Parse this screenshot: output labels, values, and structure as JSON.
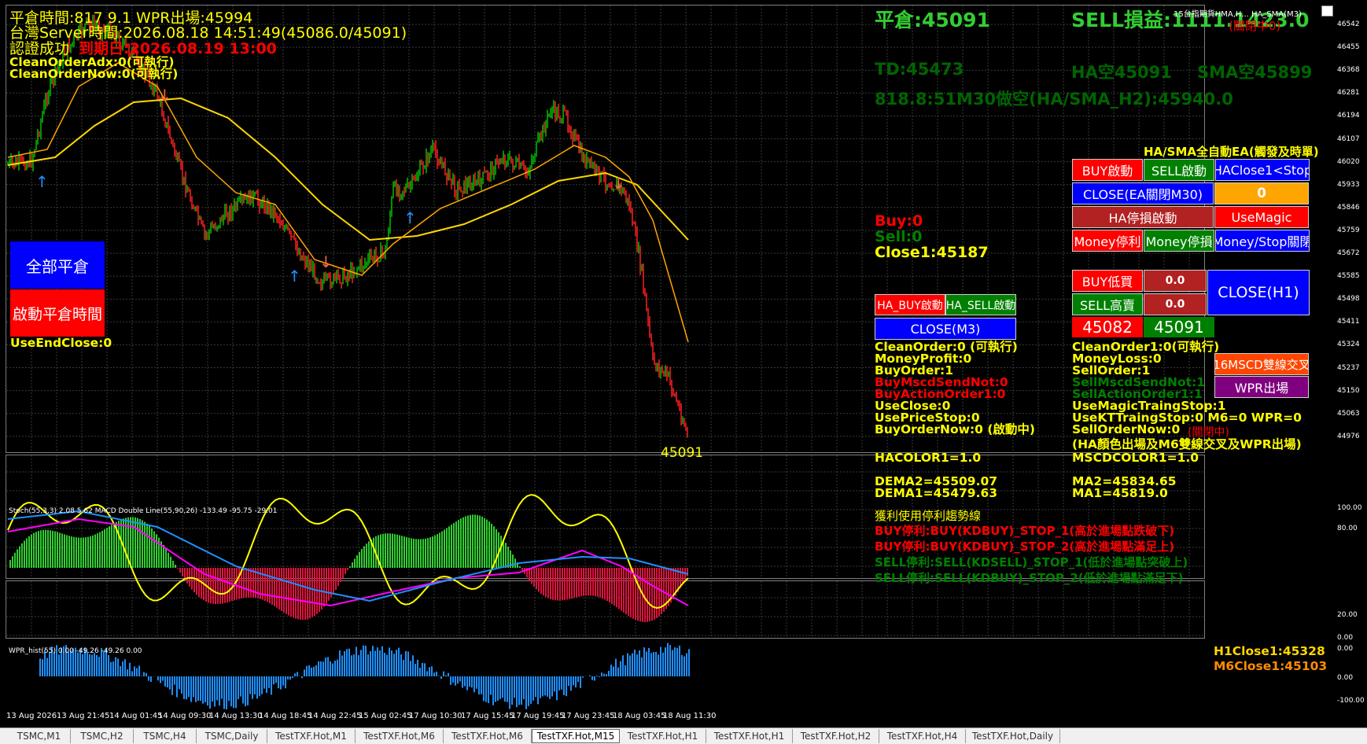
{
  "colors": {
    "bg": "#000000",
    "green": "#32cd32",
    "yellow": "#ffff00",
    "red": "#ff0000",
    "darkgreen": "#008000",
    "orange": "#ff8c00",
    "white": "#ffffff",
    "blue": "#0000ff",
    "purple": "#800080"
  },
  "top_left": {
    "line1": "平倉時間:817 9.1 WPR出場:45994",
    "line2": "台灣Server時間:2026.08.18 14:51:49(45086.0/45091)",
    "line3a": "認證成功",
    "line3b": "到期日:2026.08.19 13:00",
    "line4": "CleanOrderAdx:0(可執行)",
    "line5": "CleanOrderNow:0(可執行)"
  },
  "top_right": {
    "close_label": "平倉:45091",
    "sell_label": "SELL損益:1111.1423.0",
    "lock_status": "(關閉中0)",
    "indicator_label": "15台指期貨HMA,H... HA_SMA(M3)",
    "td": "TD:45473",
    "ha": "HA空45091",
    "sma": "SMA空45899",
    "m30": "818.8:51M30做空(HA/SMA_H2):45940.0"
  },
  "left_buttons": {
    "close_all": "全部平倉",
    "start_close_time": "啟動平倉時間",
    "use_end_close": "UseEndClose:0"
  },
  "mid_panel": {
    "buy": "Buy:0",
    "sell": "Sell:0",
    "close1": "Close1:45187",
    "ha_buy": "HA_BUY啟動",
    "ha_sell": "HA_SELL啟動",
    "close_m3": "CLOSE(M3)",
    "lines": [
      {
        "text": "CleanOrder:0 (可執行)",
        "color": "#ffff00"
      },
      {
        "text": "MoneyProfit:0",
        "color": "#ffff00"
      },
      {
        "text": "BuyOrder:1",
        "color": "#ffff00"
      },
      {
        "text": "BuyMscdSendNot:0",
        "color": "#ff0000"
      },
      {
        "text": "BuyActionOrder1:0",
        "color": "#ff0000"
      },
      {
        "text": "UseClose:0",
        "color": "#ffff00"
      },
      {
        "text": "UsePriceStop:0",
        "color": "#ffff00"
      },
      {
        "text": "BuyOrderNow:0 (啟動中)",
        "color": "#ffff00"
      }
    ],
    "hacolor": "HACOLOR1=1.0",
    "dema2": "DEMA2=45509.07",
    "dema1": "DEMA1=45479.63"
  },
  "right_panel": {
    "ea_title": "HA/SMA全自動EA(觸發及時單)",
    "buy_start": "BUY啟動",
    "sell_start": "SELL啟動",
    "haclose_stop": "HAClose1<Stop",
    "close_ea": "CLOSE(EA關閉M30)",
    "close_ea_value": "0",
    "ha_stop": "HA停損啟動",
    "use_magic": "UseMagic",
    "money_profit": "Money停利",
    "money_loss": "Money停損",
    "money_stop": "Money/Stop關閉",
    "buy_low": "BUY低買",
    "buy_low_val": "0.0",
    "sell_high": "SELL高賣",
    "sell_high_val": "0.0",
    "close_h1": "CLOSE(H1)",
    "price_buy": "45082",
    "price_sell": "45091",
    "msd": "16MSCD雙線交叉",
    "wpr": "WPR出場",
    "lines": [
      {
        "text": "CleanOrder1:0(可執行)",
        "color": "#ffff00"
      },
      {
        "text": "MoneyLoss:0",
        "color": "#ffff00"
      },
      {
        "text": "SellOrder:1",
        "color": "#ffff00"
      },
      {
        "text": "SellMscdSendNot:1",
        "color": "#008000"
      },
      {
        "text": "SellActionOrder1:1",
        "color": "#008000"
      },
      {
        "text": "UseMagicTraingStop:1",
        "color": "#ffff00"
      },
      {
        "text": "UseKTTraingStop:0  M6=0  WPR=0",
        "color": "#ffff00"
      },
      {
        "text": "SellOrderNow:0",
        "color": "#ffff00"
      }
    ],
    "sell_now_status": "(關閉中)",
    "ha_note": "(HA顏色出場及M6雙線交叉及WPR出場)",
    "mscd": "MSCDCOLOR1=1.0",
    "ma2": "MA2=45834.65",
    "ma1": "MA1=45819.0"
  },
  "price_label": "45091",
  "trend_panel": {
    "title": "獲利使用停利趨勢線",
    "lines": [
      {
        "text": "BUY停利:BUY(KDBUY)_STOP_1(高於進場點跌破下)",
        "color": "#ff0000"
      },
      {
        "text": "BUY停利:BUY(KDBUY)_STOP_2(高於進場點滿足上)",
        "color": "#ff0000"
      },
      {
        "text": "SELL停利:SELL(KDSELL)_STOP_1(低於進場點突破上)",
        "color": "#008000"
      },
      {
        "text": "SELL停利:SELL(KDBUY)_STOP_2(低於進場點滿足下)",
        "color": "#008000"
      }
    ]
  },
  "stoch_label": "Stoch(55,3,3) 2.08 5.62 MACD Double Line(55,90,26) -133.49 -95.75 -29.01",
  "wpr_label": "WPR_hist(55) 0.00 -49.26 -49.26 0.00",
  "wpr_right": {
    "h1close": "H1Close1:45328",
    "m6close": "M6Close1:45103"
  },
  "price_axis": [
    "46542",
    "46455",
    "46368",
    "46281",
    "46194",
    "46107",
    "46020",
    "45933",
    "45846",
    "45759",
    "45672",
    "45585",
    "45498",
    "45411",
    "45324",
    "45237",
    "45150",
    "45063",
    "44976"
  ],
  "stoch_axis": [
    "100.00",
    "80.00",
    "20.00",
    "0.00"
  ],
  "wpr_axis": [
    "0.00",
    "0.00",
    "-100.00"
  ],
  "time_axis": [
    "13 Aug 2026",
    "13 Aug 21:45",
    "14 Aug 01:45",
    "14 Aug 09:30",
    "14 Aug 13:30",
    "14 Aug 18:45",
    "14 Aug 22:45",
    "15 Aug 02:45",
    "17 Aug 10:30",
    "17 Aug 15:45",
    "17 Aug 19:45",
    "17 Aug 23:45",
    "18 Aug 03:45",
    "18 Aug 11:30"
  ],
  "tabs": [
    "TSMC,M1",
    "TSMC,H2",
    "TSMC,H4",
    "TSMC,Daily",
    "TestTXF.Hot,M1",
    "TestTXF.Hot,M6",
    "TestTXF.Hot,M6",
    "TestTXF.Hot,M15",
    "TestTXF.Hot,H1",
    "TestTXF.Hot,H1",
    "TestTXF.Hot,H2",
    "TestTXF.Hot,H4",
    "TestTXF.Hot,Daily"
  ],
  "active_tab": 7
}
